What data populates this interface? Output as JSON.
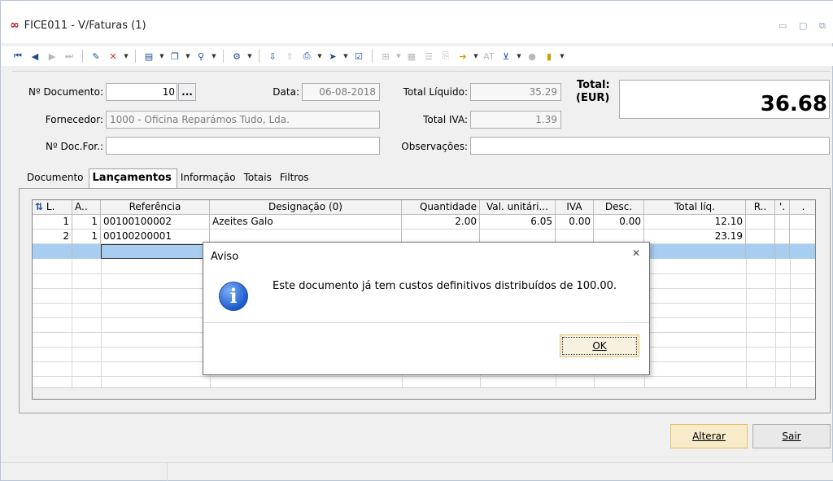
{
  "window": {
    "title": "FICE011 - V/Faturas  (1)",
    "logo": "∞"
  },
  "header": {
    "doc_label": "Nº Documento:",
    "doc_value": "10",
    "doc_browse": "...",
    "data_label": "Data:",
    "data_value": "06-08-2018",
    "total_liquido_label": "Total Líquido:",
    "total_liquido_value": "35.29",
    "total_label": "Total:",
    "total_currency": "(EUR)",
    "total_value": "36.68",
    "fornecedor_label": "Fornecedor:",
    "fornecedor_value": "1000 - Oficina Reparámos Tudo, Lda.",
    "total_iva_label": "Total IVA:",
    "total_iva_value": "1.39",
    "docfor_label": "Nº Doc.For.:",
    "docfor_value": "",
    "observacoes_label": "Observações:",
    "observacoes_value": ""
  },
  "tabs": [
    "Documento",
    "Lançamentos",
    "Informação",
    "Totais",
    "Filtros"
  ],
  "grid": {
    "columns": [
      "L.",
      "A..",
      "Referência",
      "Designação (0)",
      "Quantidade",
      "Val. unitári...",
      "IVA",
      "Desc.",
      "Total líq.",
      "R..",
      "'.",
      "."
    ],
    "rows": [
      {
        "l": "1",
        "a": "1",
        "ref": "00100100002",
        "desig": "Azeites Galo",
        "qtd": "2.00",
        "val": "6.05",
        "iva": "0.00",
        "desc": "0.00",
        "total": "12.10"
      },
      {
        "l": "2",
        "a": "1",
        "ref": "00100200001",
        "desig": "",
        "qtd": "",
        "val": "",
        "iva": "",
        "desc": "",
        "total": "23.19"
      }
    ]
  },
  "buttons": {
    "alterar": "Alterar",
    "sair": "Sair"
  },
  "dialog": {
    "title": "Aviso",
    "close": "✕",
    "icon": "i",
    "message": "Este documento já tem custos definitivos distribuídos de 100.00.",
    "ok": "OK"
  }
}
